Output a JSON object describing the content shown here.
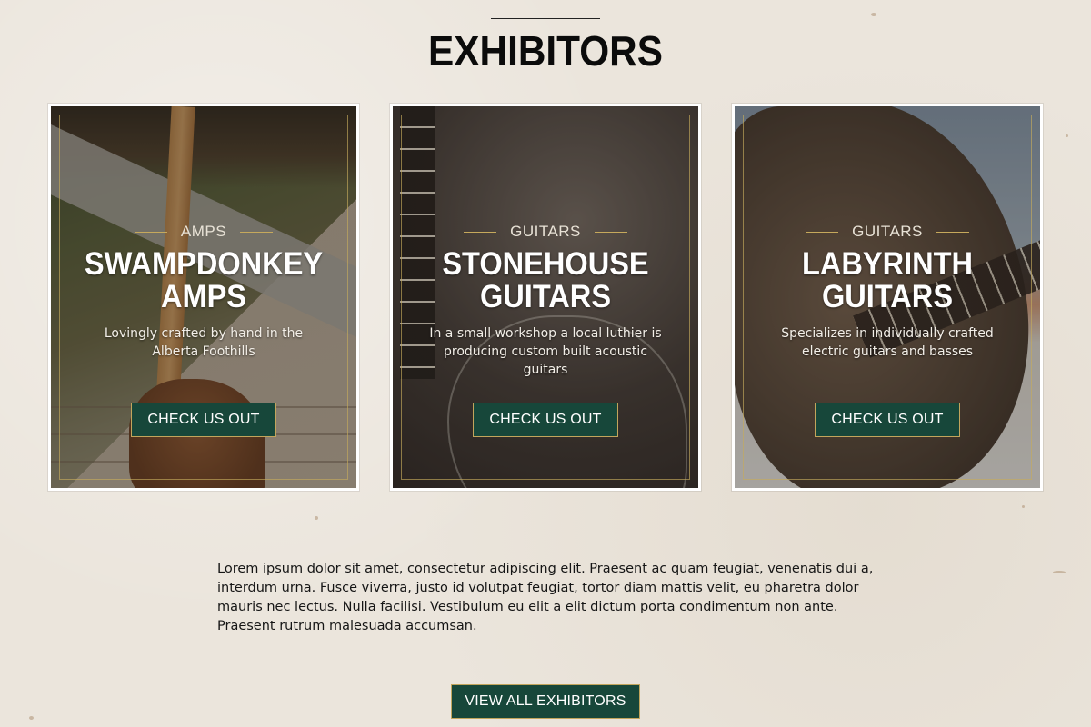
{
  "section": {
    "title": "EXHIBITORS"
  },
  "cards": [
    {
      "category": "AMPS",
      "name_line1": "SWAMPDONKEY",
      "name_line2": "AMPS",
      "description": "Lovingly crafted by hand in the Alberta Foothills",
      "button_label": "CHECK US OUT"
    },
    {
      "category": "GUITARS",
      "name_line1": "STONEHOUSE",
      "name_line2": "GUITARS",
      "description": "In a small workshop a local luthier is producing custom built acoustic guitars",
      "button_label": "CHECK US OUT"
    },
    {
      "category": "GUITARS",
      "name_line1": "LABYRINTH",
      "name_line2": "GUITARS",
      "description": "Specializes in individually crafted electric guitars and basses",
      "button_label": "CHECK US OUT"
    }
  ],
  "body_text": "Lorem ipsum dolor sit amet, consectetur adipiscing elit. Praesent ac quam feugiat, venenatis dui a, interdum urna. Fusce viverra, justo id volutpat feugiat, tortor diam mattis velit, eu pharetra dolor mauris nec lectus. Nulla facilisi. Vestibulum eu elit a elit dictum porta condimentum non ante. Praesent rutrum malesuada accumsan.",
  "view_all_label": "VIEW ALL EXHIBITORS",
  "colors": {
    "background": "#ebe5dc",
    "button": "#17473a",
    "button_border": "#c2a55c",
    "accent_gold": "#c6a95c"
  }
}
